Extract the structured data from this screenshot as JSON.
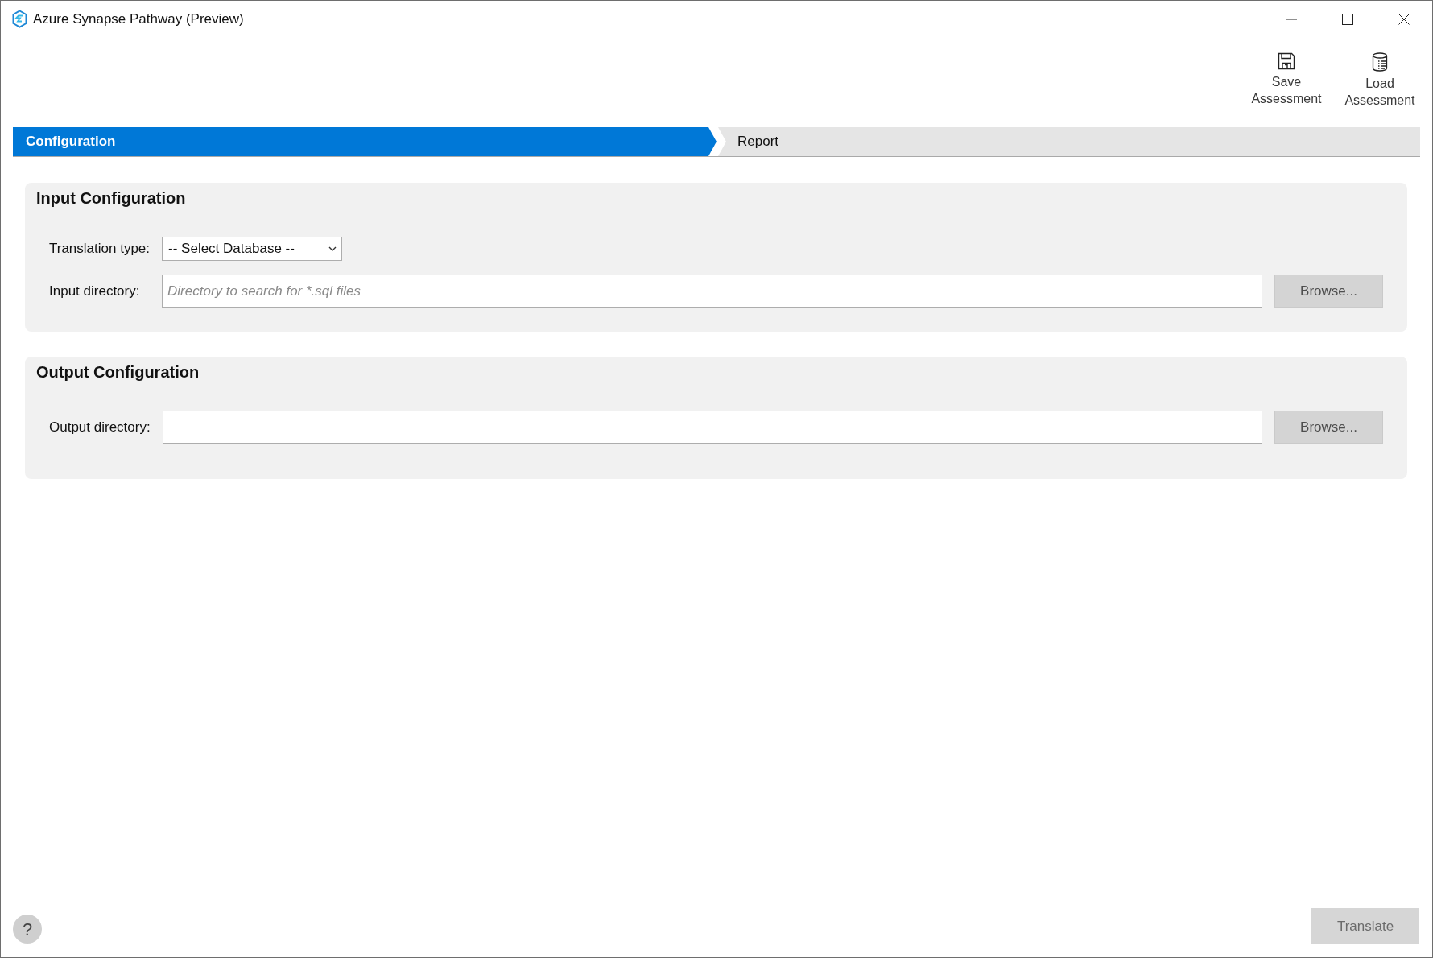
{
  "window": {
    "title": "Azure Synapse Pathway (Preview)"
  },
  "toolbar": [
    {
      "kind": "save",
      "label": "Save Assessment"
    },
    {
      "kind": "load",
      "label": "Load Assessment"
    }
  ],
  "steps": [
    {
      "label": "Configuration",
      "selected": true
    },
    {
      "label": "Report",
      "selected": false
    }
  ],
  "sections": [
    {
      "title": "Input Configuration",
      "fields": [
        {
          "kind": "select",
          "label": "Translation type:",
          "value": "-- Select Database --"
        },
        {
          "kind": "directory",
          "label": "Input directory:",
          "placeholder": "Directory to search for *.sql files",
          "button": "Browse..."
        }
      ]
    },
    {
      "title": "Output Configuration",
      "fields": [
        {
          "kind": "directory",
          "label": "Output directory:",
          "button": "Browse..."
        }
      ]
    }
  ],
  "footer": {
    "help": "?",
    "action": "Translate"
  }
}
